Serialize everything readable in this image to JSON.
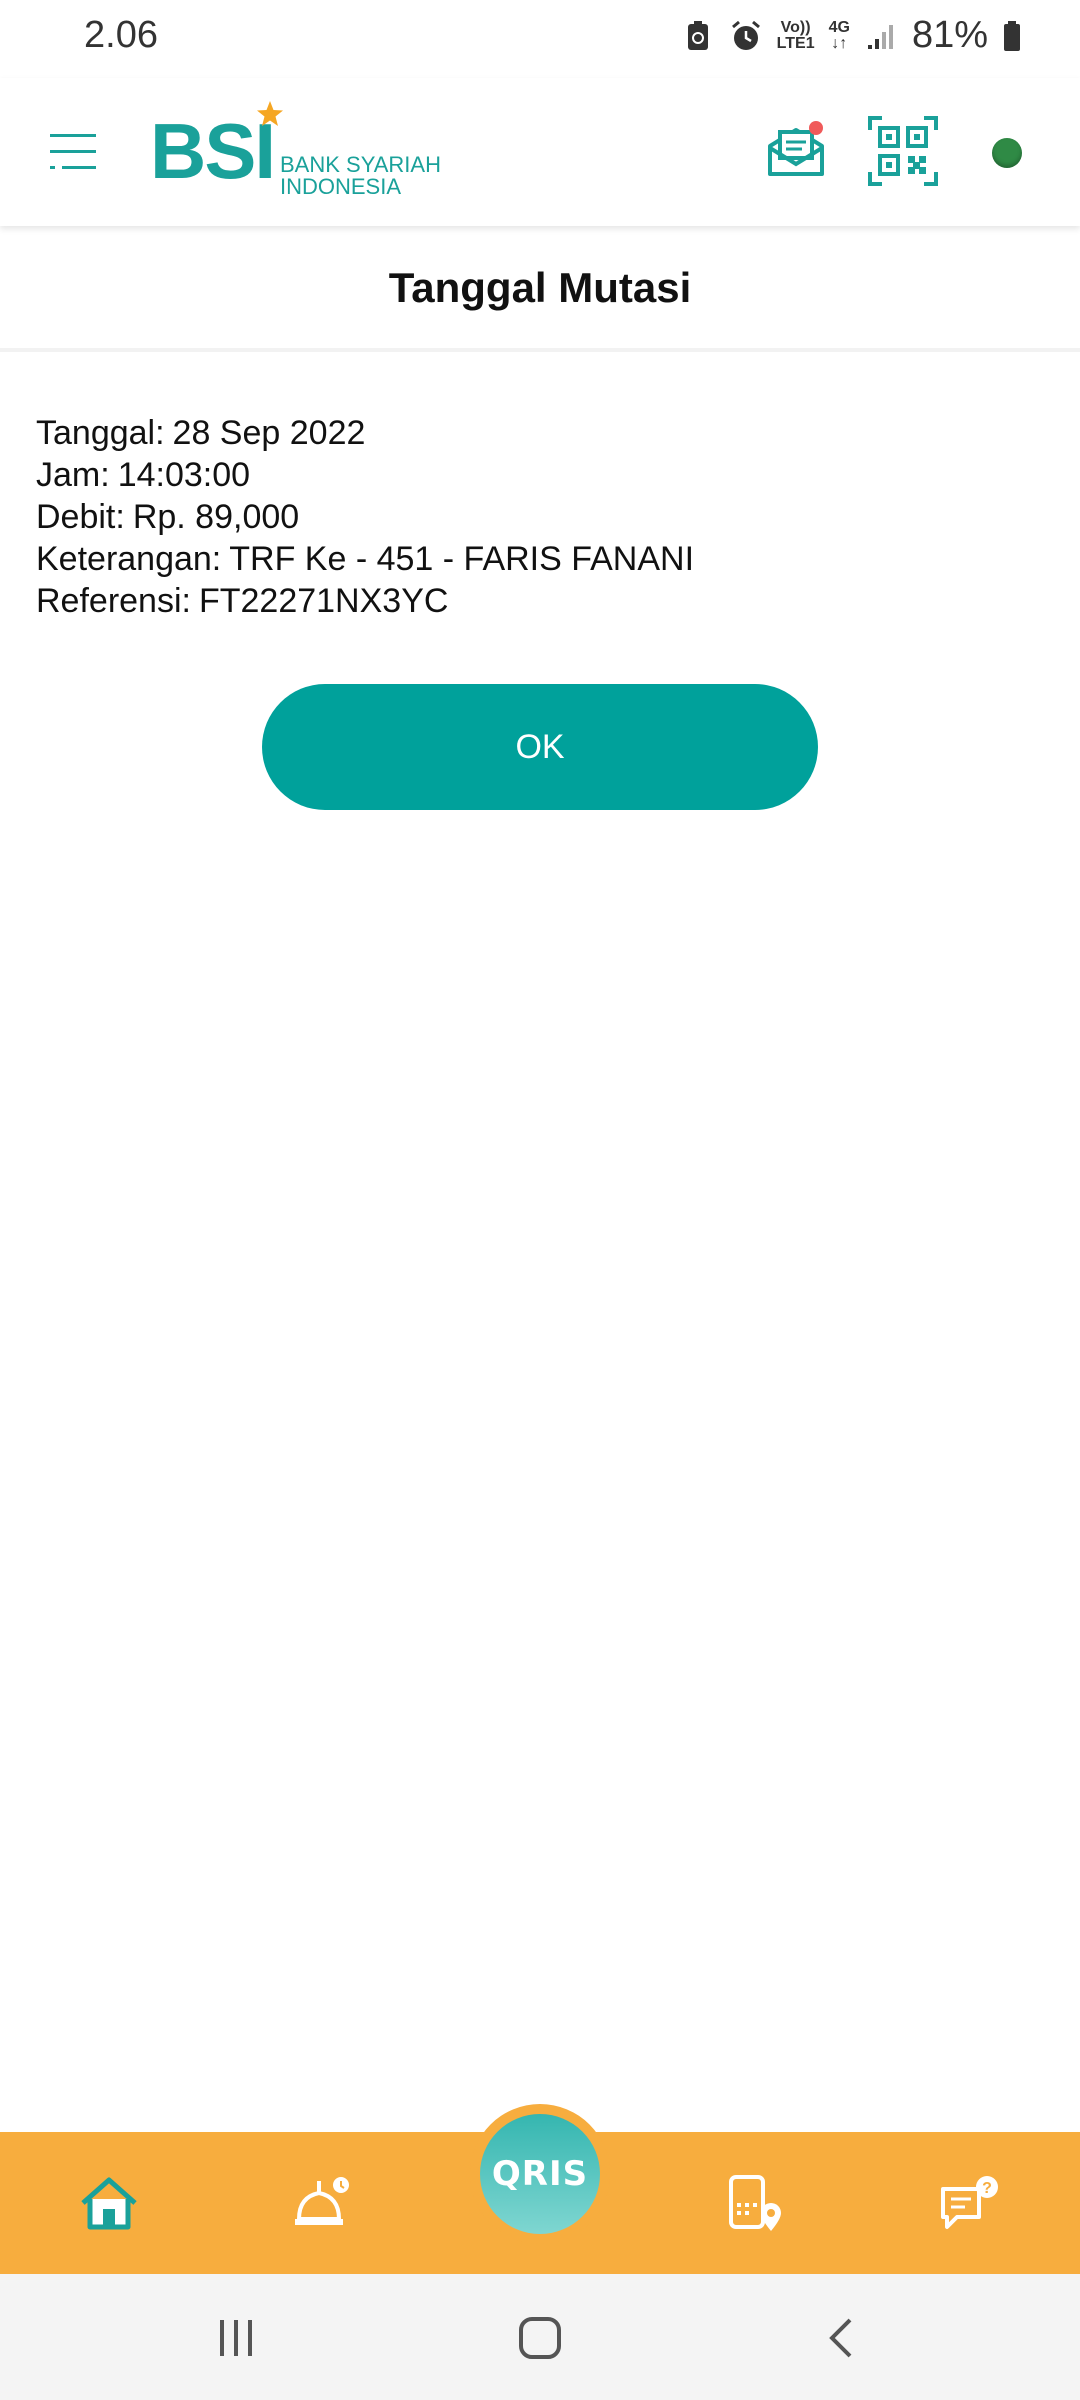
{
  "status_bar": {
    "time": "2.06",
    "volte": "Vo))",
    "lte": "LTE1",
    "network": "4G",
    "battery_percent": "81%"
  },
  "header": {
    "logo_main": "BSI",
    "logo_line1": "BANK SYARIAH",
    "logo_line2": "INDONESIA",
    "accent_color": "#1aa19a"
  },
  "page": {
    "title": "Tanggal Mutasi"
  },
  "details": [
    {
      "label": "Tanggal:",
      "value": "28 Sep 2022"
    },
    {
      "label": "Jam:",
      "value": "14:03:00"
    },
    {
      "label": "Debit:",
      "value": "Rp. 89,000"
    },
    {
      "label": "Keterangan:",
      "value": "TRF Ke - 451 - FARIS FANANI"
    },
    {
      "label": "Referensi:",
      "value": "FT22271NX3YC"
    }
  ],
  "ok_button": {
    "label": "OK",
    "color": "#00a19b"
  },
  "bottom_nav": {
    "background": "#f7ad3e",
    "qris_label": "QRIS",
    "items": [
      "home-icon",
      "mosque-icon",
      "qris-icon",
      "branch-locator-icon",
      "help-chat-icon"
    ]
  }
}
